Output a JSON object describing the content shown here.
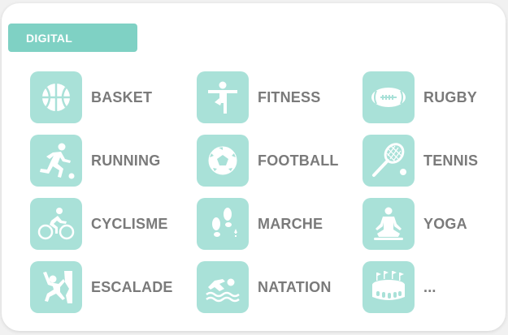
{
  "section": {
    "title": "DIGITAL"
  },
  "sports": [
    {
      "label": "BASKET",
      "icon": "basketball-icon"
    },
    {
      "label": "FITNESS",
      "icon": "fitness-icon"
    },
    {
      "label": "RUGBY",
      "icon": "rugby-ball-icon"
    },
    {
      "label": "RUNNING",
      "icon": "runner-icon"
    },
    {
      "label": "FOOTBALL",
      "icon": "soccer-ball-icon"
    },
    {
      "label": "TENNIS",
      "icon": "tennis-racket-icon"
    },
    {
      "label": "CYCLISME",
      "icon": "cyclist-icon"
    },
    {
      "label": "MARCHE",
      "icon": "footprints-icon"
    },
    {
      "label": "YOGA",
      "icon": "yoga-icon"
    },
    {
      "label": "ESCALADE",
      "icon": "climber-icon"
    },
    {
      "label": "NATATION",
      "icon": "swimmer-icon"
    },
    {
      "label": "...",
      "icon": "stadium-icon"
    }
  ],
  "colors": {
    "tag": "#7fd1c4",
    "tile": "#a9e1d8",
    "label": "#7a7a7a"
  }
}
